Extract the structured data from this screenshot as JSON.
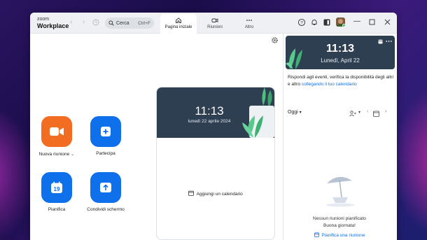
{
  "app": {
    "brand_top": "zoom",
    "brand_bottom": "Workplace"
  },
  "search": {
    "label": "Cerca",
    "shortcut": "Ctrl+F"
  },
  "tabs": [
    {
      "label": "Pagina iniziale",
      "icon": "home-icon",
      "active": true
    },
    {
      "label": "Riunioni",
      "icon": "video-icon",
      "active": false
    },
    {
      "label": "Altro",
      "icon": "more-icon",
      "active": false
    }
  ],
  "actions": {
    "new_meeting": "Nuova riunione",
    "new_meeting_chevron": "⌄",
    "join": "Partecipa",
    "schedule": "Pianifica",
    "schedule_day": "19",
    "share_screen": "Condividi schermo"
  },
  "calendar_card": {
    "time": "11:13",
    "date": "lunedì 22 aprile 2024",
    "add_calendar": "Aggiungi un calendario"
  },
  "right_panel": {
    "time": "11:13",
    "date": "Lunedì, April 22",
    "info_text": "Rispondi agli eventi, verifica la disponibilità degli altri e altro",
    "info_link": "collegando il tuo calendario",
    "today_label": "Oggi",
    "empty_title": "Nessun riunioni pianificato",
    "empty_sub": "Buona giornata!",
    "schedule_link": "Pianifica una riunione"
  },
  "colors": {
    "accent_blue": "#0e71eb",
    "orange": "#f26d21",
    "header_dark": "#2f3f52"
  }
}
